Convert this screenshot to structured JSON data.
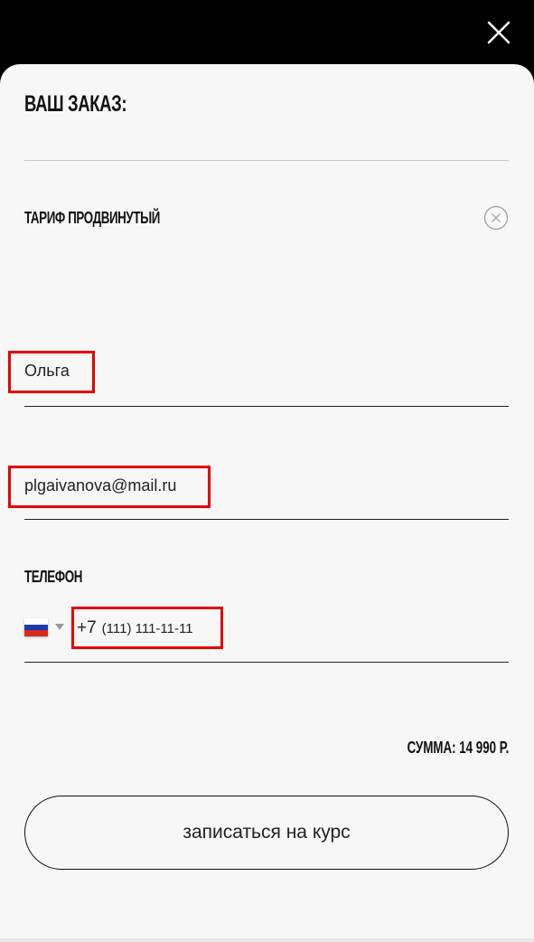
{
  "header": {
    "close_icon": "close-icon"
  },
  "order": {
    "title": "Ваш заказ:",
    "item_name": "Тариф Продвинутый",
    "remove_icon": "close-circle-icon"
  },
  "form": {
    "name_value": "Ольга",
    "email_value": "plgaivanova@mail.ru",
    "phone_label": "Телефон",
    "phone_country": "russia-flag",
    "phone_code": "+7",
    "phone_number": "(111) 111-11-11"
  },
  "summary": {
    "total_text": "Сумма: 14 990 р."
  },
  "actions": {
    "submit_label": "записаться на курс"
  },
  "colors": {
    "highlight": "#e60000",
    "panel_bg": "#f7f7f7",
    "top_bar": "#000000"
  }
}
